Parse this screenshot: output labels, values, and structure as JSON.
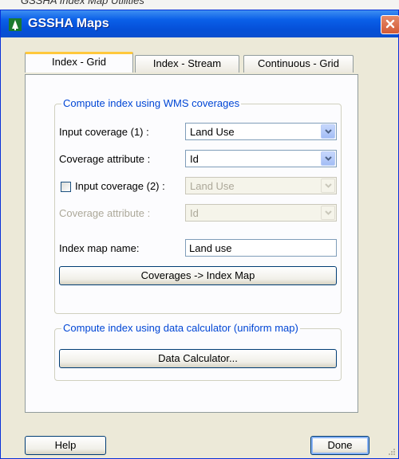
{
  "top_caption": "GSSHA Index Map Utilities",
  "window": {
    "title": "GSSHA Maps"
  },
  "tabs": [
    {
      "label": "Index - Grid"
    },
    {
      "label": "Index - Stream"
    },
    {
      "label": "Continuous - Grid"
    }
  ],
  "wms_group": {
    "label": "Compute index using WMS coverages",
    "input_coverage_1": {
      "label": "Input coverage (1) :",
      "value": "Land Use"
    },
    "coverage_attribute_1": {
      "label": "Coverage attribute :",
      "value": "Id"
    },
    "input_coverage_2": {
      "label": "Input coverage (2) :",
      "value": "Land Use",
      "checked": false
    },
    "coverage_attribute_2": {
      "label": "Coverage attribute :",
      "value": "Id"
    },
    "index_map_name": {
      "label": "Index map name:",
      "value": "Land use"
    },
    "coverages_button": "Coverages -> Index Map"
  },
  "calc_group": {
    "label": "Compute index using data calculator (uniform map)",
    "data_calculator_button": "Data Calculator..."
  },
  "footer": {
    "help_label": "Help",
    "done_label": "Done"
  },
  "colors": {
    "titlebar": "#0550d8",
    "group_label": "#0046d5",
    "active_tab_accent": "#ffc83c",
    "close_button": "#d35a36"
  }
}
